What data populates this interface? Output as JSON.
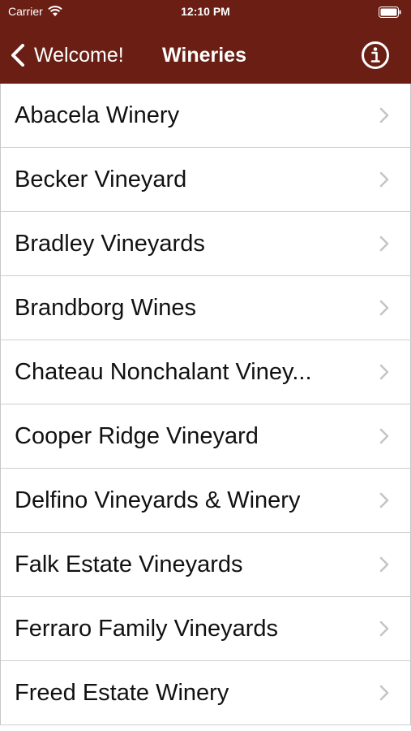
{
  "status_bar": {
    "carrier": "Carrier",
    "time": "12:10 PM"
  },
  "nav": {
    "back_label": "Welcome!",
    "title": "Wineries"
  },
  "colors": {
    "nav_background": "#6b1f14",
    "nav_text": "#ffffff",
    "chevron": "#c4c4c7"
  },
  "wineries": [
    {
      "label": "Abacela Winery"
    },
    {
      "label": "Becker Vineyard"
    },
    {
      "label": "Bradley Vineyards"
    },
    {
      "label": "Brandborg Wines"
    },
    {
      "label": "Chateau Nonchalant Viney..."
    },
    {
      "label": "Cooper Ridge Vineyard"
    },
    {
      "label": "Delfino Vineyards & Winery"
    },
    {
      "label": "Falk Estate Vineyards"
    },
    {
      "label": "Ferraro Family Vineyards"
    },
    {
      "label": "Freed Estate Winery"
    }
  ]
}
